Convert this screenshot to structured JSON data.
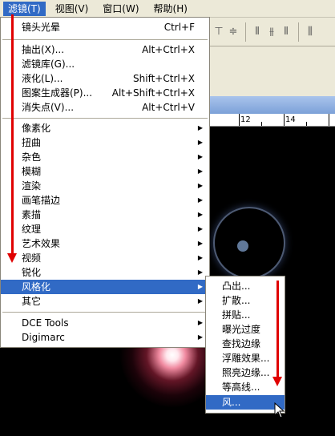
{
  "menubar": {
    "items": [
      {
        "label": "滤镜(T)",
        "active": true
      },
      {
        "label": "视图(V)",
        "active": false
      },
      {
        "label": "窗口(W)",
        "active": false
      },
      {
        "label": "帮助(H)",
        "active": false
      }
    ]
  },
  "ruler": {
    "labels": [
      "12",
      "14"
    ]
  },
  "filter_menu": {
    "group1": [
      {
        "label": "镜头光晕",
        "shortcut": "Ctrl+F"
      }
    ],
    "group2": [
      {
        "label": "抽出(X)...",
        "shortcut": "Alt+Ctrl+X"
      },
      {
        "label": "滤镜库(G)...",
        "shortcut": ""
      },
      {
        "label": "液化(L)...",
        "shortcut": "Shift+Ctrl+X"
      },
      {
        "label": "图案生成器(P)...",
        "shortcut": "Alt+Shift+Ctrl+X"
      },
      {
        "label": "消失点(V)...",
        "shortcut": "Alt+Ctrl+V"
      }
    ],
    "group3": [
      {
        "label": "像素化"
      },
      {
        "label": "扭曲"
      },
      {
        "label": "杂色"
      },
      {
        "label": "模糊"
      },
      {
        "label": "渲染"
      },
      {
        "label": "画笔描边"
      },
      {
        "label": "素描"
      },
      {
        "label": "纹理"
      },
      {
        "label": "艺术效果"
      },
      {
        "label": "视频"
      },
      {
        "label": "锐化"
      },
      {
        "label": "风格化",
        "highlighted": true
      },
      {
        "label": "其它"
      }
    ],
    "group4": [
      {
        "label": "DCE Tools"
      },
      {
        "label": "Digimarc"
      }
    ]
  },
  "stylize_submenu": {
    "items": [
      {
        "label": "凸出..."
      },
      {
        "label": "扩散..."
      },
      {
        "label": "拼贴..."
      },
      {
        "label": "曝光过度"
      },
      {
        "label": "查找边缘"
      },
      {
        "label": "浮雕效果..."
      },
      {
        "label": "照亮边缘..."
      },
      {
        "label": "等高线..."
      },
      {
        "label": "风...",
        "highlighted": true
      }
    ]
  },
  "colors": {
    "highlight": "#316ac5",
    "annotation": "#e00000",
    "menu_bg": "#ffffff",
    "chrome": "#ece9d8"
  }
}
